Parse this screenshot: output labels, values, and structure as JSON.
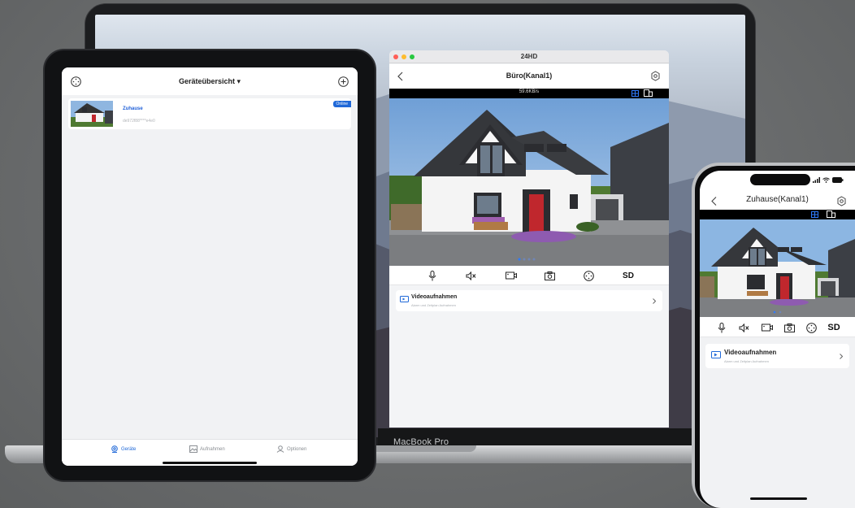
{
  "mac": {
    "device_label": "MacBook Pro",
    "window": {
      "title": "24HD",
      "nav_title": "Büro(Kanal1)",
      "speed": "59.6KB/s",
      "sd_label": "SD",
      "recordings": {
        "title": "Videoaufnahmen",
        "subtitle": "Alarm und Zeitplan Aufnahmen"
      }
    }
  },
  "ipad": {
    "header_title": "Geräteübersicht ▾",
    "device": {
      "name": "Zuhause",
      "id": "de972f88****e4e0",
      "status": "Online"
    },
    "tabs": [
      {
        "label": "Geräte",
        "icon": "camera-icon",
        "active": true
      },
      {
        "label": "Aufnahmen",
        "icon": "image-icon",
        "active": false
      },
      {
        "label": "Optionen",
        "icon": "user-icon",
        "active": false
      }
    ]
  },
  "iphone": {
    "nav_title": "Zuhause(Kanal1)",
    "sd_label": "SD",
    "recordings": {
      "title": "Videoaufnahmen",
      "subtitle": "Alarm und Zeitplan Aufnahmen"
    }
  },
  "colors": {
    "accent": "#1f68d8",
    "background": "#6a6c6d",
    "door_red": "#c0272d"
  }
}
